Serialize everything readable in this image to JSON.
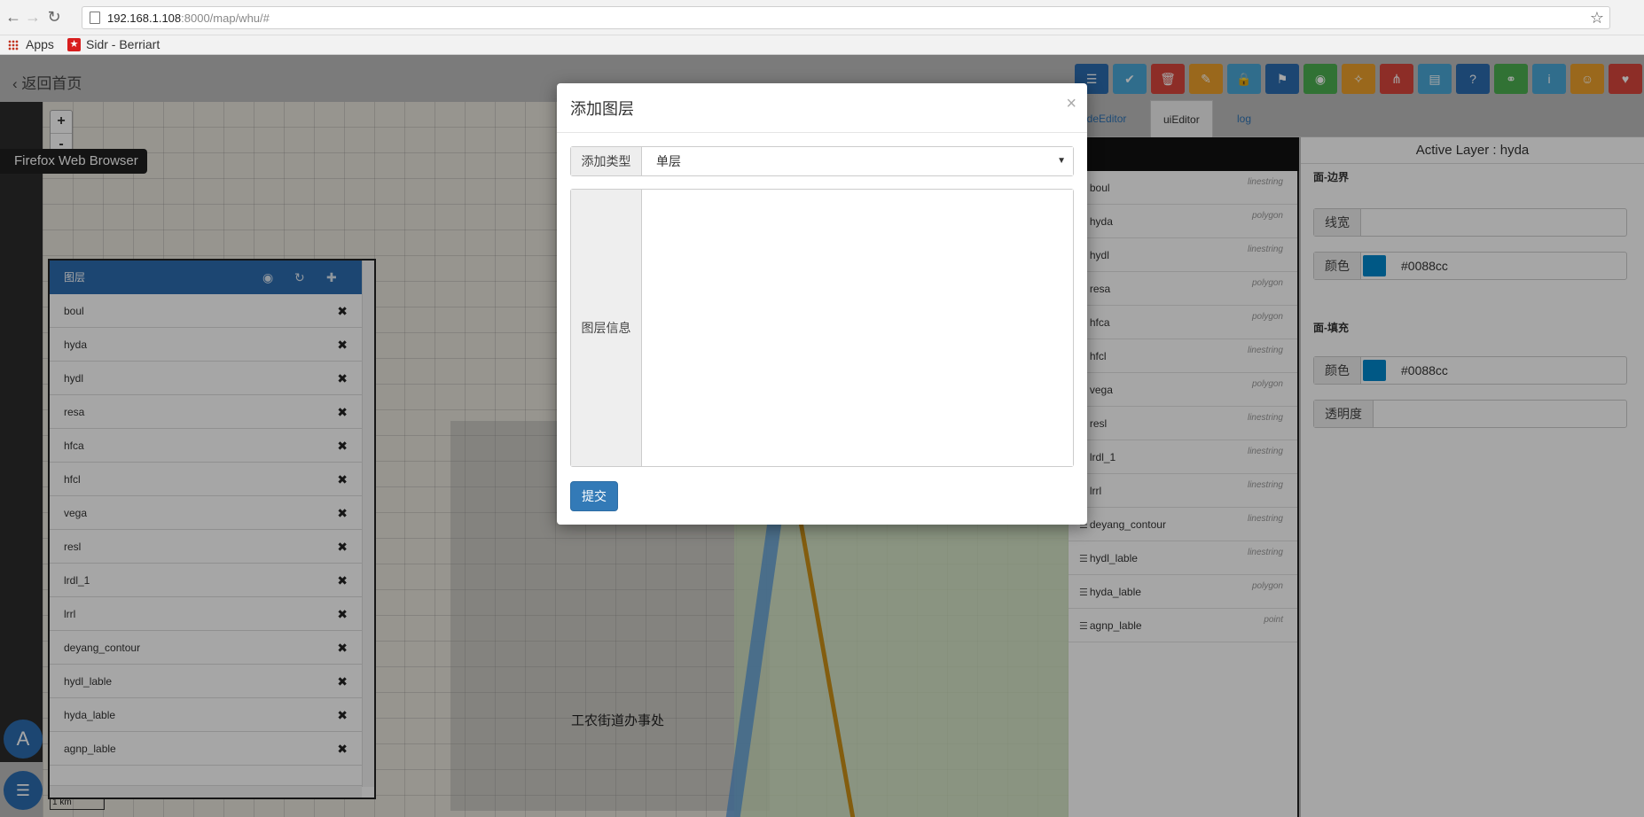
{
  "browser": {
    "url_host": "192.168.1.108",
    "url_rest": ":8000/map/whu/#",
    "bookmarks": [
      "Apps",
      "Sidr - Berriart"
    ],
    "tooltip": "Firefox Web Browser"
  },
  "app": {
    "back_label": "返回首页",
    "map_label": "工农街道办事处",
    "scale_label": "1 km",
    "zoom_in": "+",
    "zoom_out": "-",
    "fab_a": "A"
  },
  "layer_panel": {
    "title": "图层",
    "layers": [
      "boul",
      "hyda",
      "hydl",
      "resa",
      "hfca",
      "hfcl",
      "vega",
      "resl",
      "lrdl_1",
      "lrrl",
      "deyang_contour",
      "hydl_lable",
      "hyda_lable",
      "agnp_lable"
    ]
  },
  "toolbar": {
    "buttons": [
      {
        "icon": "list-icon",
        "color": "#2c6cb0",
        "glyph": "☰"
      },
      {
        "icon": "check-icon",
        "color": "#4aa8d8",
        "glyph": "✔"
      },
      {
        "icon": "trash-icon",
        "color": "#d9453c",
        "glyph": "🗑"
      },
      {
        "icon": "pencil-icon",
        "color": "#eda02b",
        "glyph": "✎"
      },
      {
        "icon": "lock-icon",
        "color": "#4aa8d8",
        "glyph": "🔒"
      },
      {
        "icon": "flag-icon",
        "color": "#2c6cb0",
        "glyph": "⚑"
      },
      {
        "icon": "camera-icon",
        "color": "#4caf50",
        "glyph": "◉"
      },
      {
        "icon": "wrench-icon",
        "color": "#eda02b",
        "glyph": "✧"
      },
      {
        "icon": "share-icon",
        "color": "#d9453c",
        "glyph": "⋔"
      },
      {
        "icon": "file-icon",
        "color": "#4aa8d8",
        "glyph": "▤"
      },
      {
        "icon": "question-icon",
        "color": "#2c6cb0",
        "glyph": "?"
      },
      {
        "icon": "link-icon",
        "color": "#4caf50",
        "glyph": "⚭"
      },
      {
        "icon": "info-icon",
        "color": "#4aa8d8",
        "glyph": "i"
      },
      {
        "icon": "user-icon",
        "color": "#eda02b",
        "glyph": "☺"
      },
      {
        "icon": "heart-icon",
        "color": "#d9453c",
        "glyph": "♥"
      }
    ]
  },
  "tabs": [
    "odeEditor",
    "uiEditor",
    "log"
  ],
  "geom_list": [
    {
      "name": "boul",
      "type": "linestring"
    },
    {
      "name": "hyda",
      "type": "polygon"
    },
    {
      "name": "hydl",
      "type": "linestring"
    },
    {
      "name": "resa",
      "type": "polygon"
    },
    {
      "name": "hfca",
      "type": "polygon"
    },
    {
      "name": "hfcl",
      "type": "linestring"
    },
    {
      "name": "vega",
      "type": "polygon"
    },
    {
      "name": "resl",
      "type": "linestring"
    },
    {
      "name": "lrdl_1",
      "type": "linestring"
    },
    {
      "name": "lrrl",
      "type": "linestring"
    },
    {
      "name": "deyang_contour",
      "type": "linestring"
    },
    {
      "name": "hydl_lable",
      "type": "linestring"
    },
    {
      "name": "hyda_lable",
      "type": "polygon"
    },
    {
      "name": "agnp_lable",
      "type": "point"
    }
  ],
  "style_panel": {
    "active_layer": "Active Layer : hyda",
    "border_section": "面-边界",
    "line_width_label": "线宽",
    "line_width_value": "",
    "border_color_label": "颜色",
    "border_color_value": "#0088cc",
    "fill_section": "面-填充",
    "fill_color_label": "颜色",
    "fill_color_value": "#0088cc",
    "opacity_label": "透明度",
    "opacity_value": ""
  },
  "modal": {
    "title": "添加图层",
    "close": "×",
    "type_label": "添加类型",
    "type_value": "单层",
    "info_label": "图层信息",
    "info_value": "",
    "submit": "提交"
  }
}
